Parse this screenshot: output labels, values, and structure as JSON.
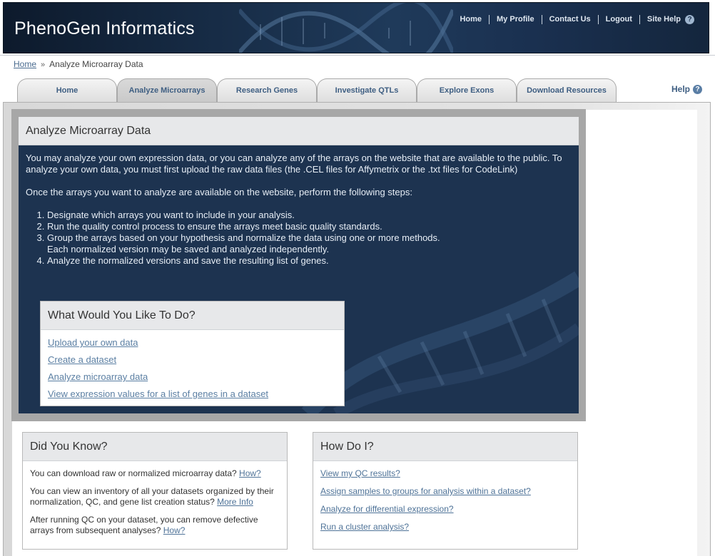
{
  "header": {
    "logo": "PhenoGen Informatics",
    "nav": [
      "Home",
      "My Profile",
      "Contact Us",
      "Logout",
      "Site Help"
    ]
  },
  "breadcrumb": {
    "home": "Home",
    "separator": "»",
    "current": "Analyze Microarray Data"
  },
  "tabs": [
    {
      "label": "Home",
      "active": false
    },
    {
      "label": "Analyze Microarrays",
      "active": true
    },
    {
      "label": "Research Genes",
      "active": false
    },
    {
      "label": "Investigate QTLs",
      "active": false
    },
    {
      "label": "Explore Exons",
      "active": false
    },
    {
      "label": "Download Resources",
      "active": false
    }
  ],
  "help_label": "Help",
  "hero": {
    "title": "Analyze Microarray Data",
    "intro": "You may analyze your own expression data, or you can analyze any of the arrays on the website that are available to the public. To analyze your own data, you must first upload the raw data files (the .CEL files for Affymetrix or the .txt files for CodeLink)",
    "steps_intro": "Once the arrays you want to analyze are available on the website, perform the following steps:",
    "steps": [
      "Designate which arrays you want to include in your analysis.",
      "Run the quality control process to ensure the arrays meet basic quality standards.",
      "Group the arrays based on your hypothesis and normalize the data using one or more methods. Each normalized version may be saved and analyzed independently.",
      "Analyze the normalized versions and save the resulting list of genes."
    ]
  },
  "todo": {
    "title": "What Would You Like To Do?",
    "links": [
      "Upload your own data",
      "Create a dataset",
      "Analyze microarray data",
      "View expression values for a list of genes in a dataset"
    ]
  },
  "did_you_know": {
    "title": "Did You Know?",
    "items": [
      {
        "text": "You can download raw or normalized microarray data? ",
        "link": "How?"
      },
      {
        "text": "You can view an inventory of all your datasets organized by their normalization, QC, and gene list creation status? ",
        "link": "More Info"
      },
      {
        "text": "After running QC on your dataset, you can remove defective arrays from subsequent analyses? ",
        "link": "How?"
      }
    ]
  },
  "how_do_i": {
    "title": "How Do I?",
    "links": [
      "View my QC results?",
      "Assign samples to groups for analysis within a dataset?",
      "Analyze for differential expression?",
      "Run a cluster analysis?"
    ]
  }
}
